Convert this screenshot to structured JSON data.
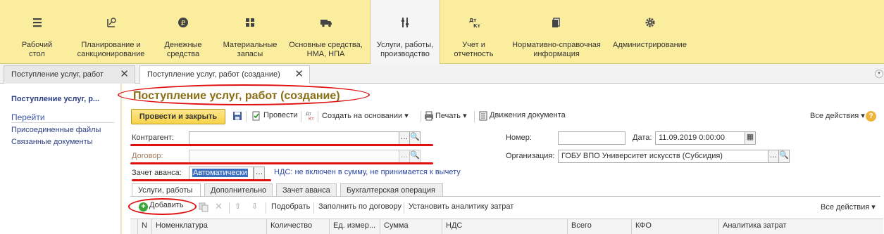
{
  "sections": [
    {
      "label": "Рабочий\nстол",
      "icon": "menu-icon"
    },
    {
      "label": "Планирование и\nсанкционирование",
      "icon": "planning-icon"
    },
    {
      "label": "Денежные\nсредства",
      "icon": "ruble-icon"
    },
    {
      "label": "Материальные\nзапасы",
      "icon": "grid-icon"
    },
    {
      "label": "Основные средства,\nНМА, НПА",
      "icon": "truck-icon"
    },
    {
      "label": "Услуги, работы,\nпроизводство",
      "icon": "tools-icon"
    },
    {
      "label": "Учет и\nотчетность",
      "icon": "dt-kt-icon"
    },
    {
      "label": "Нормативно-справочная\nинформация",
      "icon": "books-icon"
    },
    {
      "label": "Администрирование",
      "icon": "gear-icon"
    }
  ],
  "window_tabs": [
    {
      "label": "Поступление услуг, работ"
    },
    {
      "label": "Поступление услуг, работ (создание)"
    }
  ],
  "leftnav": {
    "current": "Поступление услуг, р...",
    "goto": "Перейти",
    "links": [
      "Присоединенные файлы",
      "Связанные документы"
    ]
  },
  "form": {
    "title": "Поступление услуг, работ (создание)",
    "toolbar": {
      "post_close": "Провести и закрыть",
      "post": "Провести",
      "create_based": "Создать на основании",
      "print": "Печать",
      "movements": "Движения документа",
      "all_actions": "Все действия",
      "help": "?"
    },
    "fields": {
      "counterparty_label": "Контрагент:",
      "counterparty_value": "",
      "contract_label": "Договор:",
      "contract_value": "",
      "advance_label": "Зачет аванса:",
      "advance_value": "Автоматически",
      "vat_text": "НДС: не включен в сумму, не принимается к вычету",
      "number_label": "Номер:",
      "number_value": "",
      "date_label": "Дата:",
      "date_value": "11.09.2019  0:00:00",
      "org_label": "Организация:",
      "org_value": "ГОБУ ВПО Университет искусств (Субсидия)"
    },
    "tabs": [
      "Услуги, работы",
      "Дополнительно",
      "Зачет аванса",
      "Бухгалтерская операция"
    ],
    "table_toolbar": {
      "add": "Добавить",
      "select": "Подобрать",
      "fill_contract": "Заполнить по договору",
      "set_analytics": "Установить аналитику затрат",
      "all_actions": "Все действия"
    },
    "columns": [
      "N",
      "Номенклатура",
      "Количество",
      "Ед. измер...",
      "Сумма",
      "НДС",
      "Всего",
      "КФО",
      "Аналитика затрат"
    ]
  }
}
